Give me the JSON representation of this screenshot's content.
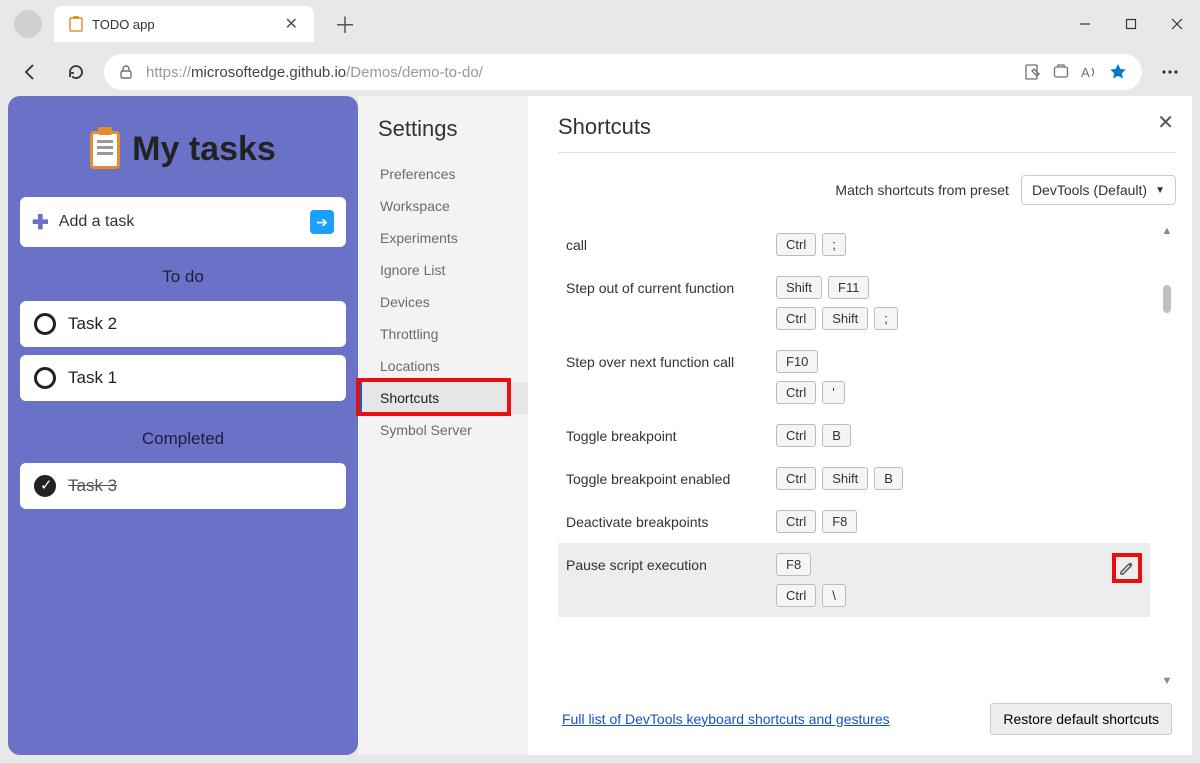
{
  "browser": {
    "tab_title": "TODO app",
    "url_prefix": "https://",
    "url_host": "microsoftedge.github.io",
    "url_path": "/Demos/demo-to-do/"
  },
  "todo": {
    "title": "My tasks",
    "add_placeholder": "Add a task",
    "section_todo": "To do",
    "section_done": "Completed",
    "tasks_open": [
      "Task 2",
      "Task 1"
    ],
    "tasks_done": [
      "Task 3"
    ]
  },
  "settings": {
    "title": "Settings",
    "items": [
      "Preferences",
      "Workspace",
      "Experiments",
      "Ignore List",
      "Devices",
      "Throttling",
      "Locations",
      "Shortcuts",
      "Symbol Server"
    ],
    "active_index": 7
  },
  "shortcuts": {
    "panel_title": "Shortcuts",
    "preset_label": "Match shortcuts from preset",
    "preset_value": "DevTools (Default)",
    "rows": [
      {
        "name": "call",
        "keys": [
          [
            "Ctrl",
            ";"
          ]
        ]
      },
      {
        "name": "Step out of current function",
        "keys": [
          [
            "Shift",
            "F11"
          ],
          [
            "Ctrl",
            "Shift",
            ";"
          ]
        ]
      },
      {
        "name": "Step over next function call",
        "keys": [
          [
            "F10"
          ],
          [
            "Ctrl",
            "'"
          ]
        ]
      },
      {
        "name": "Toggle breakpoint",
        "keys": [
          [
            "Ctrl",
            "B"
          ]
        ]
      },
      {
        "name": "Toggle breakpoint enabled",
        "keys": [
          [
            "Ctrl",
            "Shift",
            "B"
          ]
        ]
      },
      {
        "name": "Deactivate breakpoints",
        "keys": [
          [
            "Ctrl",
            "F8"
          ]
        ]
      },
      {
        "name": "Pause script execution",
        "keys": [
          [
            "F8"
          ],
          [
            "Ctrl",
            "\\"
          ]
        ],
        "highlight": true,
        "show_edit": true
      }
    ],
    "footer_link": "Full list of DevTools keyboard shortcuts and gestures",
    "restore_button": "Restore default shortcuts"
  }
}
